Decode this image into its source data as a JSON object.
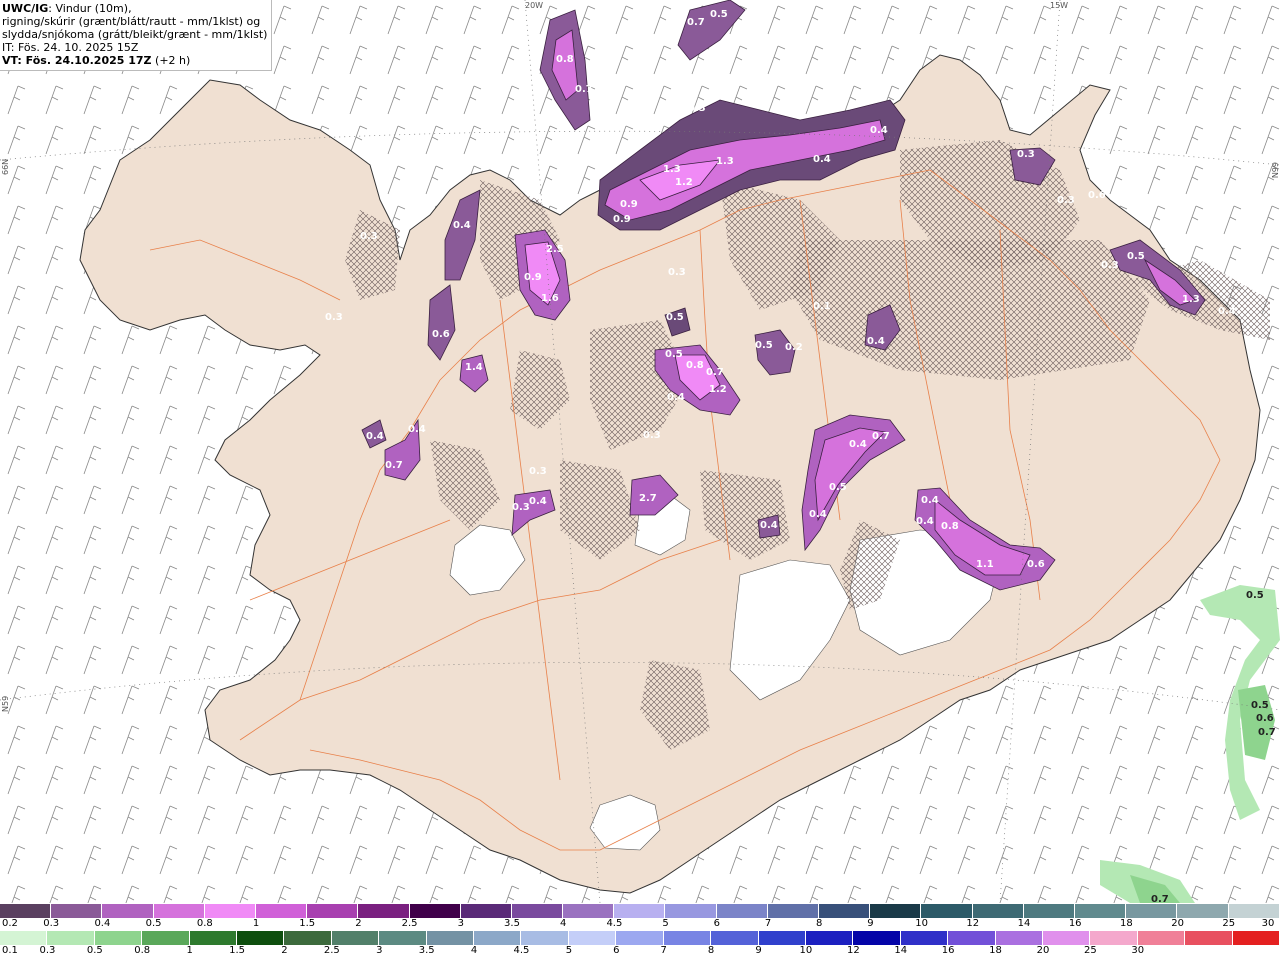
{
  "title": {
    "model": "UWC/IG",
    "line1": ": Vindur (10m),",
    "line2": "rigning/skúrir (grænt/blátt/rautt - mm/1klst) og",
    "line3": "slydda/snjókoma (grátt/bleikt/grænt - mm/1klst)",
    "it": "IT: Fös. 24. 10. 2025 15Z",
    "vt_label": "VT: Fös. 24.10.2025 17Z",
    "vt_offset": "(+2 h)"
  },
  "grid_labels": {
    "top_20w": "20W",
    "top_15w": "15W",
    "left_66n": "66N",
    "left_65n": "N59",
    "right_66n": "66N"
  },
  "snow_scale": {
    "colors": [
      "#5a4060",
      "#8a5a98",
      "#b062c0",
      "#d572dc",
      "#f08af6",
      "#d060d8",
      "#a840b0",
      "#7a2080",
      "#40004a",
      "#5a2a78",
      "#7a4a9e",
      "#9a72c0",
      "#b8b0f0",
      "#9898e0",
      "#7b84c8",
      "#6070a8",
      "#38507a",
      "#1a3a48",
      "#2c5a68",
      "#3e6a74",
      "#4e7a80",
      "#608a8e",
      "#7898a0",
      "#8ea8ae",
      "#c4d2d4"
    ],
    "ticks": [
      "0.2",
      "0.3",
      "0.4",
      "0.5",
      "0.8",
      "1",
      "1.5",
      "2",
      "2.5",
      "3",
      "3.5",
      "4",
      "4.5",
      "5",
      "6",
      "7",
      "8",
      "9",
      "10",
      "12",
      "14",
      "16",
      "18",
      "20",
      "25",
      "30"
    ]
  },
  "rain_scale": {
    "colors": [
      "#d4f4d4",
      "#b4e8b4",
      "#8ed48e",
      "#5aa85a",
      "#2e7a2e",
      "#0e4e0e",
      "#3c6a3c",
      "#52806a",
      "#5c8a82",
      "#7492a4",
      "#8ca8c8",
      "#a8bce4",
      "#c4cef8",
      "#9ca8f0",
      "#7884e4",
      "#5462d8",
      "#3040cc",
      "#1c20c0",
      "#0404a8",
      "#3030c8",
      "#7250d8",
      "#aa70e0",
      "#e090ec",
      "#f4a8cc",
      "#f08098",
      "#e85060",
      "#e42020"
    ],
    "ticks": [
      "0.1",
      "0.3",
      "0.5",
      "0.8",
      "1",
      "1.5",
      "2",
      "2.5",
      "3",
      "3.5",
      "4",
      "4.5",
      "5",
      "6",
      "7",
      "8",
      "9",
      "10",
      "12",
      "14",
      "16",
      "18",
      "20",
      "25",
      "30"
    ]
  },
  "precip_labels": {
    "snow": [
      "0.5",
      "0.7",
      "0.8",
      "0.7",
      "0.3",
      "0.3",
      "1.3",
      "1.3",
      "1.2",
      "0.9",
      "0.9",
      "0.4",
      "0.4",
      "0.3",
      "0.4",
      "2.5",
      "0.9",
      "1.6",
      "0.3",
      "0.3",
      "0.6",
      "1.4",
      "0.4",
      "0.7",
      "0.4",
      "0.5",
      "0.5",
      "0.8",
      "0.7",
      "0.4",
      "1.2",
      "0.5",
      "0.2",
      "0.1",
      "0.4",
      "0.3",
      "0.3",
      "0.4",
      "0.4",
      "0.7",
      "0.5",
      "0.4",
      "2.7",
      "0.3",
      "0.4",
      "0.4",
      "0.4",
      "0.8",
      "1.1",
      "0.6",
      "0.3",
      "0.6",
      "0.3",
      "1.3",
      "0.5",
      "0.3",
      "0.4"
    ],
    "rain": [
      "0.5",
      "0.5",
      "0.6",
      "0.7",
      "0.7"
    ]
  }
}
